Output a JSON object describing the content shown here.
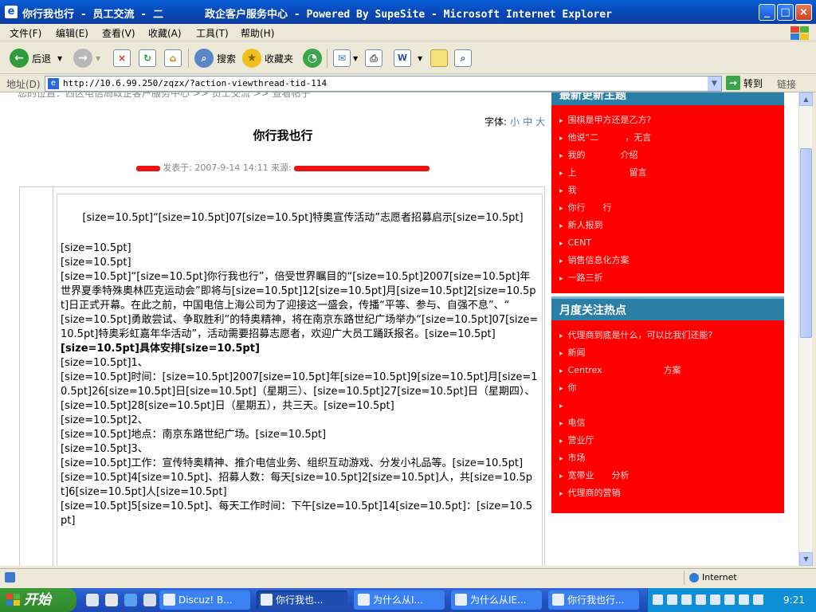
{
  "window": {
    "title": "你行我也行 - 员工交流 - 二　　　　政企客户服务中心 - Powered By SupeSite - Microsoft Internet Explorer",
    "min_label": "_",
    "max_label": "□",
    "close_label": "×"
  },
  "menu": [
    "文件(F)",
    "编辑(E)",
    "查看(V)",
    "收藏(A)",
    "工具(T)",
    "帮助(H)"
  ],
  "toolbar": {
    "back": "后退",
    "search": "搜索",
    "favorites": "收藏夹"
  },
  "address": {
    "label": "地址(D)",
    "url": "http://10.6.99.250/zqzx/?action-viewthread-tid-114",
    "go": "转到",
    "links": "链接"
  },
  "page": {
    "breadcrumb": "您的位置：西区电信局政企客户服务中心 >> 员工交流 >> 查看帖子",
    "fontsize_label": "字体:",
    "fontsize_options": [
      "小",
      "中",
      "大"
    ],
    "title": "你行我也行",
    "meta_posted": "发表于: 2007-9-14 14:11 来源:",
    "post_headline": "[size=10.5pt]“[size=10.5pt]07[size=10.5pt]特奥宣传活动”志愿者招募启示[size=10.5pt]",
    "post_lines": [
      {
        "text": "[size=10.5pt]",
        "bold": false
      },
      {
        "text": "[size=10.5pt]",
        "bold": false
      },
      {
        "text": "[size=10.5pt]“[size=10.5pt]你行我也行”，倍受世界瞩目的“[size=10.5pt]2007[size=10.5pt]年世界夏季特殊奥林匹克运动会”即将与[size=10.5pt]12[size=10.5pt]月[size=10.5pt]2[size=10.5pt]日正式开幕。在此之前，中国电信上海公司为了迎接这一盛会，传播“平等、参与、自强不息”、“",
        "bold": false
      },
      {
        "text": "[size=10.5pt]勇敢尝试、争取胜利”的特奥精神，将在南京东路世纪广场举办“[size=10.5pt]07[size=10.5pt]特奥彩虹嘉年华活动”，活动需要招募志愿者，欢迎广大员工踊跃报名。[size=10.5pt]",
        "bold": false
      },
      {
        "text": "[size=10.5pt]具体安排[size=10.5pt]",
        "bold": true
      },
      {
        "text": "[size=10.5pt]1、",
        "bold": false
      },
      {
        "text": "[size=10.5pt]时间：[size=10.5pt]2007[size=10.5pt]年[size=10.5pt]9[size=10.5pt]月[size=10.5pt]26[size=10.5pt]日[size=10.5pt]（星期三）、[size=10.5pt]27[size=10.5pt]日（星期四）、[size=10.5pt]28[size=10.5pt]日（星期五），共三天。[size=10.5pt]",
        "bold": false
      },
      {
        "text": "[size=10.5pt]2、",
        "bold": false
      },
      {
        "text": "[size=10.5pt]地点：南京东路世纪广场。[size=10.5pt]",
        "bold": false
      },
      {
        "text": "[size=10.5pt]3、",
        "bold": false
      },
      {
        "text": "[size=10.5pt]工作：宣传特奥精神、推介电信业务、组织互动游戏、分发小礼品等。[size=10.5pt]",
        "bold": false
      },
      {
        "text": "[size=10.5pt]4[size=10.5pt]、招募人数：每天[size=10.5pt]2[size=10.5pt]人，共[size=10.5pt]6[size=10.5pt]人[size=10.5pt]",
        "bold": false
      },
      {
        "text": "[size=10.5pt]5[size=10.5pt]、每天工作时间：下午[size=10.5pt]14[size=10.5pt]：[size=10.5pt]",
        "bold": false
      }
    ]
  },
  "sidebar": {
    "box1_title": "最新更新主题",
    "box1_items": [
      "围棋是甲方还是乙方?",
      "他说“二　　　，无言",
      "我的　　　　介绍",
      "上　　　　　　留言",
      "我　　　",
      "你行　　行",
      "新人报到　　",
      "CENT　　　　",
      "销售信息化方案",
      "一路三折"
    ],
    "box2_title": "月度关注热点",
    "box2_items": [
      "代理商到底是什么，可以比我们还能?",
      "新闻　　　",
      "Centrex　　　　　　　方案",
      "你　　　",
      "　　　　　　　",
      "电信　　　　　　　　",
      "营业厅　　　　　　",
      "市场　　",
      "宽带业　　分析",
      "代理商的营销"
    ]
  },
  "status": {
    "zone": "Internet"
  },
  "taskbar": {
    "start": "开始",
    "tasks": [
      "Discuz! B...",
      "你行我也...",
      "为什么从I...",
      "为什么从IE...",
      "你行我也行..."
    ],
    "active_index": 1,
    "clock": "9:21"
  },
  "colors": {
    "sidebar_bg": "#ff0000",
    "sidebar_header": "#2b7fa6",
    "titlebar": "#0846b5",
    "taskbar": "#2456c7",
    "start": "#2f8a2c"
  }
}
